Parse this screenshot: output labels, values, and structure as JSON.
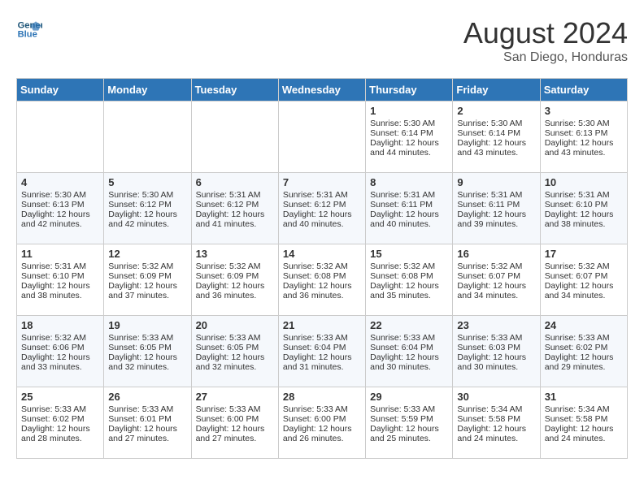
{
  "header": {
    "logo_line1": "General",
    "logo_line2": "Blue",
    "month_year": "August 2024",
    "location": "San Diego, Honduras"
  },
  "days_of_week": [
    "Sunday",
    "Monday",
    "Tuesday",
    "Wednesday",
    "Thursday",
    "Friday",
    "Saturday"
  ],
  "weeks": [
    [
      {
        "day": "",
        "info": ""
      },
      {
        "day": "",
        "info": ""
      },
      {
        "day": "",
        "info": ""
      },
      {
        "day": "",
        "info": ""
      },
      {
        "day": "1",
        "info": "Sunrise: 5:30 AM\nSunset: 6:14 PM\nDaylight: 12 hours\nand 44 minutes."
      },
      {
        "day": "2",
        "info": "Sunrise: 5:30 AM\nSunset: 6:14 PM\nDaylight: 12 hours\nand 43 minutes."
      },
      {
        "day": "3",
        "info": "Sunrise: 5:30 AM\nSunset: 6:13 PM\nDaylight: 12 hours\nand 43 minutes."
      }
    ],
    [
      {
        "day": "4",
        "info": "Sunrise: 5:30 AM\nSunset: 6:13 PM\nDaylight: 12 hours\nand 42 minutes."
      },
      {
        "day": "5",
        "info": "Sunrise: 5:30 AM\nSunset: 6:12 PM\nDaylight: 12 hours\nand 42 minutes."
      },
      {
        "day": "6",
        "info": "Sunrise: 5:31 AM\nSunset: 6:12 PM\nDaylight: 12 hours\nand 41 minutes."
      },
      {
        "day": "7",
        "info": "Sunrise: 5:31 AM\nSunset: 6:12 PM\nDaylight: 12 hours\nand 40 minutes."
      },
      {
        "day": "8",
        "info": "Sunrise: 5:31 AM\nSunset: 6:11 PM\nDaylight: 12 hours\nand 40 minutes."
      },
      {
        "day": "9",
        "info": "Sunrise: 5:31 AM\nSunset: 6:11 PM\nDaylight: 12 hours\nand 39 minutes."
      },
      {
        "day": "10",
        "info": "Sunrise: 5:31 AM\nSunset: 6:10 PM\nDaylight: 12 hours\nand 38 minutes."
      }
    ],
    [
      {
        "day": "11",
        "info": "Sunrise: 5:31 AM\nSunset: 6:10 PM\nDaylight: 12 hours\nand 38 minutes."
      },
      {
        "day": "12",
        "info": "Sunrise: 5:32 AM\nSunset: 6:09 PM\nDaylight: 12 hours\nand 37 minutes."
      },
      {
        "day": "13",
        "info": "Sunrise: 5:32 AM\nSunset: 6:09 PM\nDaylight: 12 hours\nand 36 minutes."
      },
      {
        "day": "14",
        "info": "Sunrise: 5:32 AM\nSunset: 6:08 PM\nDaylight: 12 hours\nand 36 minutes."
      },
      {
        "day": "15",
        "info": "Sunrise: 5:32 AM\nSunset: 6:08 PM\nDaylight: 12 hours\nand 35 minutes."
      },
      {
        "day": "16",
        "info": "Sunrise: 5:32 AM\nSunset: 6:07 PM\nDaylight: 12 hours\nand 34 minutes."
      },
      {
        "day": "17",
        "info": "Sunrise: 5:32 AM\nSunset: 6:07 PM\nDaylight: 12 hours\nand 34 minutes."
      }
    ],
    [
      {
        "day": "18",
        "info": "Sunrise: 5:32 AM\nSunset: 6:06 PM\nDaylight: 12 hours\nand 33 minutes."
      },
      {
        "day": "19",
        "info": "Sunrise: 5:33 AM\nSunset: 6:05 PM\nDaylight: 12 hours\nand 32 minutes."
      },
      {
        "day": "20",
        "info": "Sunrise: 5:33 AM\nSunset: 6:05 PM\nDaylight: 12 hours\nand 32 minutes."
      },
      {
        "day": "21",
        "info": "Sunrise: 5:33 AM\nSunset: 6:04 PM\nDaylight: 12 hours\nand 31 minutes."
      },
      {
        "day": "22",
        "info": "Sunrise: 5:33 AM\nSunset: 6:04 PM\nDaylight: 12 hours\nand 30 minutes."
      },
      {
        "day": "23",
        "info": "Sunrise: 5:33 AM\nSunset: 6:03 PM\nDaylight: 12 hours\nand 30 minutes."
      },
      {
        "day": "24",
        "info": "Sunrise: 5:33 AM\nSunset: 6:02 PM\nDaylight: 12 hours\nand 29 minutes."
      }
    ],
    [
      {
        "day": "25",
        "info": "Sunrise: 5:33 AM\nSunset: 6:02 PM\nDaylight: 12 hours\nand 28 minutes."
      },
      {
        "day": "26",
        "info": "Sunrise: 5:33 AM\nSunset: 6:01 PM\nDaylight: 12 hours\nand 27 minutes."
      },
      {
        "day": "27",
        "info": "Sunrise: 5:33 AM\nSunset: 6:00 PM\nDaylight: 12 hours\nand 27 minutes."
      },
      {
        "day": "28",
        "info": "Sunrise: 5:33 AM\nSunset: 6:00 PM\nDaylight: 12 hours\nand 26 minutes."
      },
      {
        "day": "29",
        "info": "Sunrise: 5:33 AM\nSunset: 5:59 PM\nDaylight: 12 hours\nand 25 minutes."
      },
      {
        "day": "30",
        "info": "Sunrise: 5:34 AM\nSunset: 5:58 PM\nDaylight: 12 hours\nand 24 minutes."
      },
      {
        "day": "31",
        "info": "Sunrise: 5:34 AM\nSunset: 5:58 PM\nDaylight: 12 hours\nand 24 minutes."
      }
    ]
  ]
}
